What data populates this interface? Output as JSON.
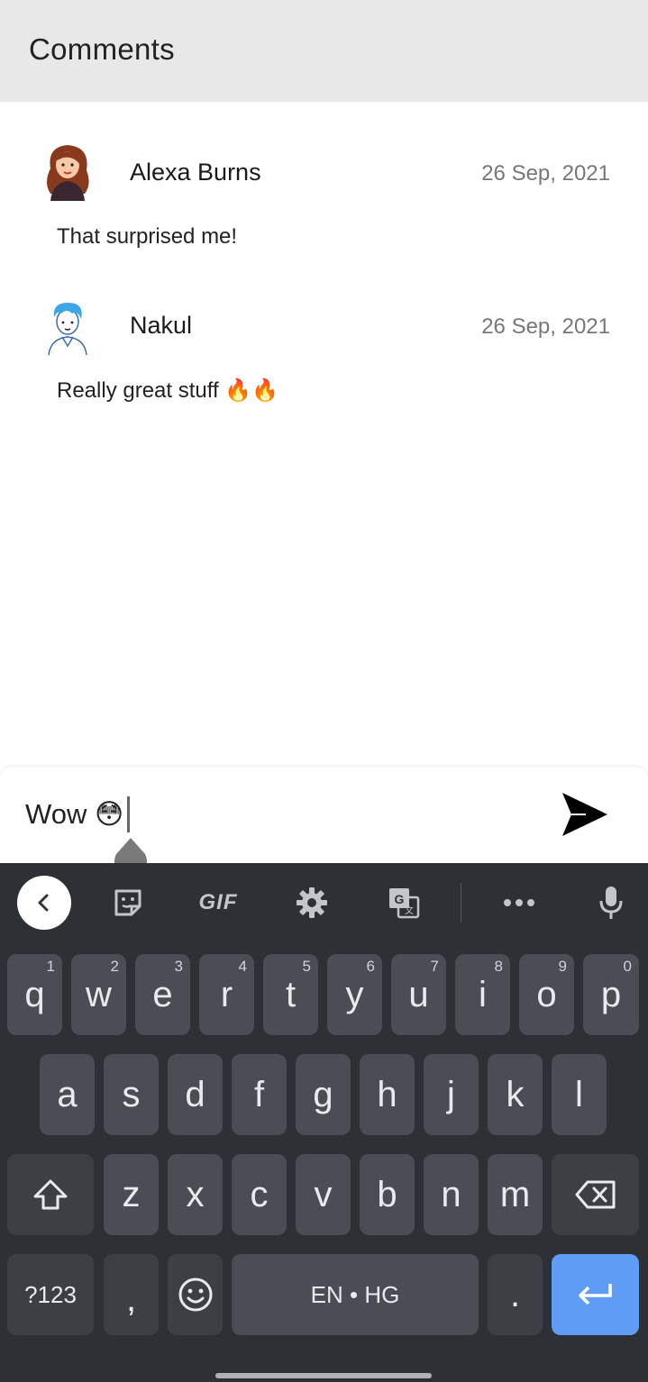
{
  "header": {
    "title": "Comments"
  },
  "comments": [
    {
      "author": "Alexa Burns",
      "date": "26 Sep, 2021",
      "text": "That surprised me!"
    },
    {
      "author": "Nakul",
      "date": "26 Sep, 2021",
      "text": "Really great stuff 🔥🔥"
    }
  ],
  "composer": {
    "value": "Wow 😳"
  },
  "keyboard": {
    "toolbar": {
      "gif_label": "GIF"
    },
    "row1": [
      {
        "key": "q",
        "hint": "1"
      },
      {
        "key": "w",
        "hint": "2"
      },
      {
        "key": "e",
        "hint": "3"
      },
      {
        "key": "r",
        "hint": "4"
      },
      {
        "key": "t",
        "hint": "5"
      },
      {
        "key": "y",
        "hint": "6"
      },
      {
        "key": "u",
        "hint": "7"
      },
      {
        "key": "i",
        "hint": "8"
      },
      {
        "key": "o",
        "hint": "9"
      },
      {
        "key": "p",
        "hint": "0"
      }
    ],
    "row2": [
      "a",
      "s",
      "d",
      "f",
      "g",
      "h",
      "j",
      "k",
      "l"
    ],
    "row3": [
      "z",
      "x",
      "c",
      "v",
      "b",
      "n",
      "m"
    ],
    "symbols_label": "?123",
    "comma": ",",
    "space_label": "EN • HG",
    "period": "."
  },
  "colors": {
    "header_bg": "#e8e8e8",
    "keyboard_bg": "#2d3136",
    "key_bg": "#4a4e54",
    "enter_key": "#5f9cf5"
  }
}
